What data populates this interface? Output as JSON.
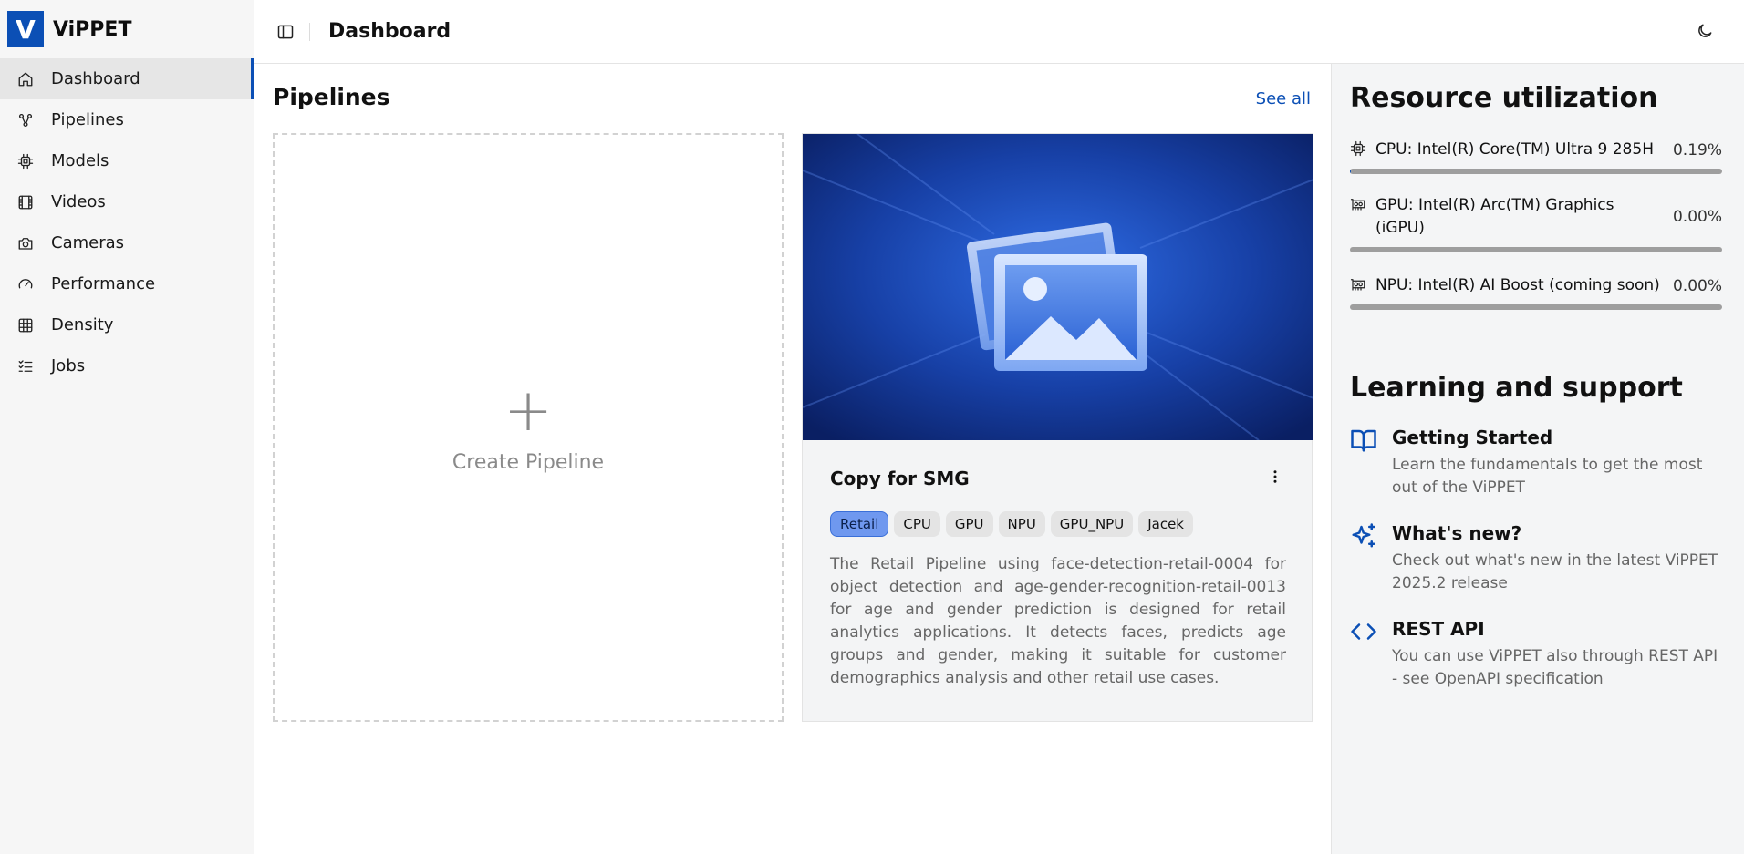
{
  "app": {
    "logo_letter": "V",
    "name": "ViPPET",
    "brand_color": "#0b4fb5"
  },
  "sidebar": {
    "items": [
      {
        "label": "Dashboard",
        "icon": "home-icon",
        "active": true
      },
      {
        "label": "Pipelines",
        "icon": "workflow-icon"
      },
      {
        "label": "Models",
        "icon": "chip-icon"
      },
      {
        "label": "Videos",
        "icon": "film-icon"
      },
      {
        "label": "Cameras",
        "icon": "camera-icon"
      },
      {
        "label": "Performance",
        "icon": "gauge-icon"
      },
      {
        "label": "Density",
        "icon": "grid-icon"
      },
      {
        "label": "Jobs",
        "icon": "list-checks-icon"
      }
    ]
  },
  "header": {
    "title": "Dashboard",
    "sidebar_toggle_icon": "panel-left-icon",
    "theme_toggle_icon": "moon-icon"
  },
  "pipelines": {
    "title": "Pipelines",
    "see_all": "See all",
    "create_icon": "plus-icon",
    "create_label": "Create Pipeline",
    "cards": [
      {
        "name": "Copy for SMG",
        "thumbnail_icon": "image-gallery-icon",
        "menu_icon": "more-vertical-icon",
        "tags": [
          "Retail",
          "CPU",
          "GPU",
          "NPU",
          "GPU_NPU",
          "Jacek"
        ],
        "description": "The Retail Pipeline using face-detection-retail-0004 for object detection and age-gender-recognition-retail-0013 for age and gender prediction is designed for retail analytics applications. It detects faces, predicts age groups and gender, making it suitable for customer demographics analysis and other retail use cases."
      }
    ]
  },
  "resources": {
    "title": "Resource utilization",
    "items": [
      {
        "label": "CPU: Intel(R) Core(TM) Ultra 9 285H",
        "value": "0.19%",
        "percent": 0.19,
        "icon": "cpu-icon"
      },
      {
        "label": "GPU: Intel(R) Arc(TM) Graphics (iGPU)",
        "value": "0.00%",
        "percent": 0.0,
        "icon": "gpu-card-icon"
      },
      {
        "label": "NPU: Intel(R) AI Boost (coming soon)",
        "value": "0.00%",
        "percent": 0.0,
        "icon": "npu-card-icon"
      }
    ]
  },
  "learning": {
    "title": "Learning and support",
    "items": [
      {
        "title": "Getting Started",
        "desc": "Learn the fundamentals to get the most out of the ViPPET",
        "icon": "book-open-icon"
      },
      {
        "title": "What's new?",
        "desc": "Check out what's new in the latest ViPPET 2025.2 release",
        "icon": "sparkles-icon"
      },
      {
        "title": "REST API",
        "desc": "You can use ViPPET also through REST API - see OpenAPI specification",
        "icon": "code-icon"
      }
    ]
  }
}
